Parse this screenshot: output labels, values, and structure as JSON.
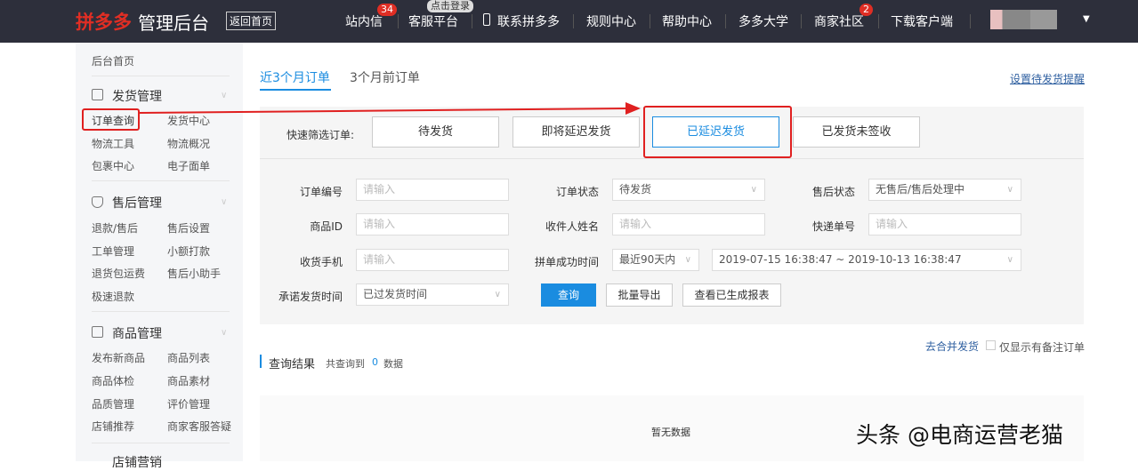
{
  "header": {
    "logo_brand": "拼多多",
    "logo_suffix": "管理后台",
    "home_button": "返回首页",
    "nav": [
      {
        "label": "站内信",
        "badge": "34"
      },
      {
        "label": "客服平台",
        "tooltip": "点击登录"
      },
      {
        "label": "联系拼多多"
      },
      {
        "label": "规则中心"
      },
      {
        "label": "帮助中心"
      },
      {
        "label": "多多大学"
      },
      {
        "label": "商家社区",
        "badge": "2"
      },
      {
        "label": "下载客户端"
      }
    ]
  },
  "sidebar": {
    "home": "后台首页",
    "sections": [
      {
        "title": "发货管理",
        "items": [
          "订单查询",
          "发货中心",
          "物流工具",
          "物流概况",
          "包裹中心",
          "电子面单"
        ]
      },
      {
        "title": "售后管理",
        "items": [
          "退款/售后",
          "售后设置",
          "工单管理",
          "小额打款",
          "退货包运费",
          "售后小助手",
          "极速退款"
        ]
      },
      {
        "title": "商品管理",
        "items": [
          "发布新商品",
          "商品列表",
          "商品体检",
          "商品素材",
          "品质管理",
          "评价管理",
          "店铺推荐",
          "商家客服答疑"
        ]
      },
      {
        "title": "店铺营销",
        "items": []
      }
    ]
  },
  "tabs": [
    "近3个月订单",
    "3个月前订单"
  ],
  "reminder_link": "设置待发货提醒",
  "quick_filter": {
    "label": "快速筛选订单:",
    "options": [
      "待发货",
      "即将延迟发货",
      "已延迟发货",
      "已发货未签收"
    ],
    "selected": "已延迟发货"
  },
  "form": {
    "order_no": {
      "label": "订单编号",
      "placeholder": "请输入"
    },
    "order_status": {
      "label": "订单状态",
      "value": "待发货"
    },
    "after_sale_status": {
      "label": "售后状态",
      "value": "无售后/售后处理中"
    },
    "product_id": {
      "label": "商品ID",
      "placeholder": "请输入"
    },
    "receiver_name": {
      "label": "收件人姓名",
      "placeholder": "请输入"
    },
    "tracking_no": {
      "label": "快递单号",
      "placeholder": "请输入"
    },
    "phone": {
      "label": "收货手机",
      "placeholder": "请输入"
    },
    "group_time": {
      "label": "拼单成功时间",
      "range": "最近90天内",
      "dates": "2019-07-15 16:38:47 ~ 2019-10-13 16:38:47"
    },
    "promise_time": {
      "label": "承诺发货时间",
      "value": "已过发货时间"
    },
    "query_button": "查询",
    "export_button": "批量导出",
    "reports_button": "查看已生成报表"
  },
  "results": {
    "merge_link": "去合并发货",
    "remark_only": "仅显示有备注订单",
    "title": "查询结果",
    "count_prefix": "共查询到",
    "count": "0",
    "count_suffix": "数据",
    "empty": "暂无数据"
  },
  "watermark": "头条 @电商运营老猫"
}
